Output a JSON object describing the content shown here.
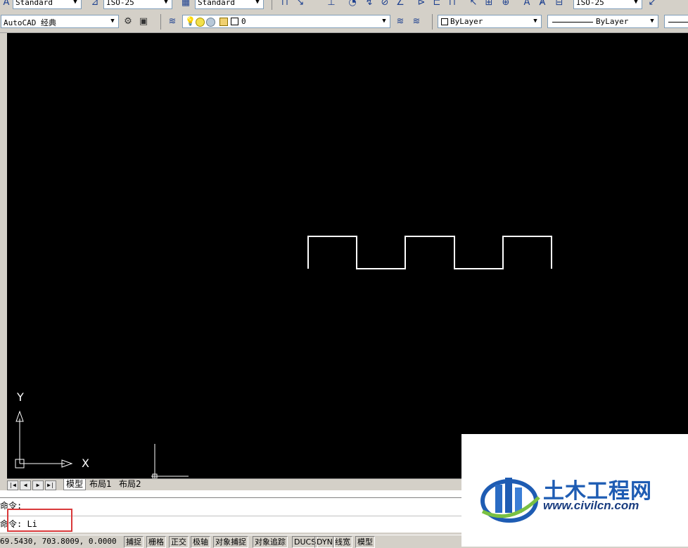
{
  "toolbar_top": {
    "text_style": "Standard",
    "dim_style": "ISO-25",
    "table_style": "Standard",
    "multileader_style": "ISO-25"
  },
  "toolbar_second": {
    "workspace": "AutoCAD 经典",
    "layer": "0",
    "color": "ByLayer",
    "linetype": "ByLayer"
  },
  "ucs": {
    "y_label": "Y",
    "x_label": "X"
  },
  "drawing": {
    "shape": "square-wave polyline",
    "stroke_color": "#ffffff"
  },
  "layout_tabs": {
    "model": "模型",
    "layout1": "布局1",
    "layout2": "布局2"
  },
  "command": {
    "history": "命令:",
    "current": "命令: Li"
  },
  "status": {
    "coordinates": "69.5430,  703.8009,  0.0000",
    "buttons": [
      "捕捉",
      "栅格",
      "正交",
      "极轴",
      "对象捕捉",
      "对象追踪",
      "DUCS",
      "DYN",
      "线宽",
      "模型"
    ]
  },
  "watermark": {
    "brand": "土木工程网",
    "url": "www.civilcn.com"
  },
  "colors": {
    "canvas_bg": "#000000",
    "highlight_box": "#d9393a",
    "logo_blue": "#1e5cb3"
  }
}
